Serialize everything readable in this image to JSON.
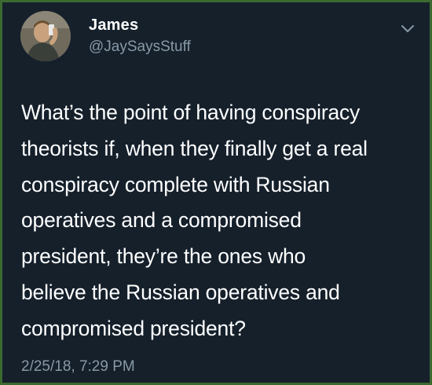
{
  "tweet": {
    "author_name": "James",
    "author_handle": "@JaySaysStuff",
    "lines": [
      "What’s the point of having conspiracy",
      "theorists if, when they finally get a real",
      "conspiracy complete with Russian",
      "operatives and a compromised",
      "president, they’re the ones who",
      "believe the Russian operatives and",
      "compromised president?"
    ],
    "timestamp": "2/25/18, 7:29 PM"
  },
  "icons": {
    "avatar": "user-avatar-photo",
    "menu": "chevron-down-icon"
  },
  "colors": {
    "background": "#15202b",
    "border": "#3b6a2f",
    "text_primary": "#ffffff",
    "text_secondary": "#8899a6"
  }
}
